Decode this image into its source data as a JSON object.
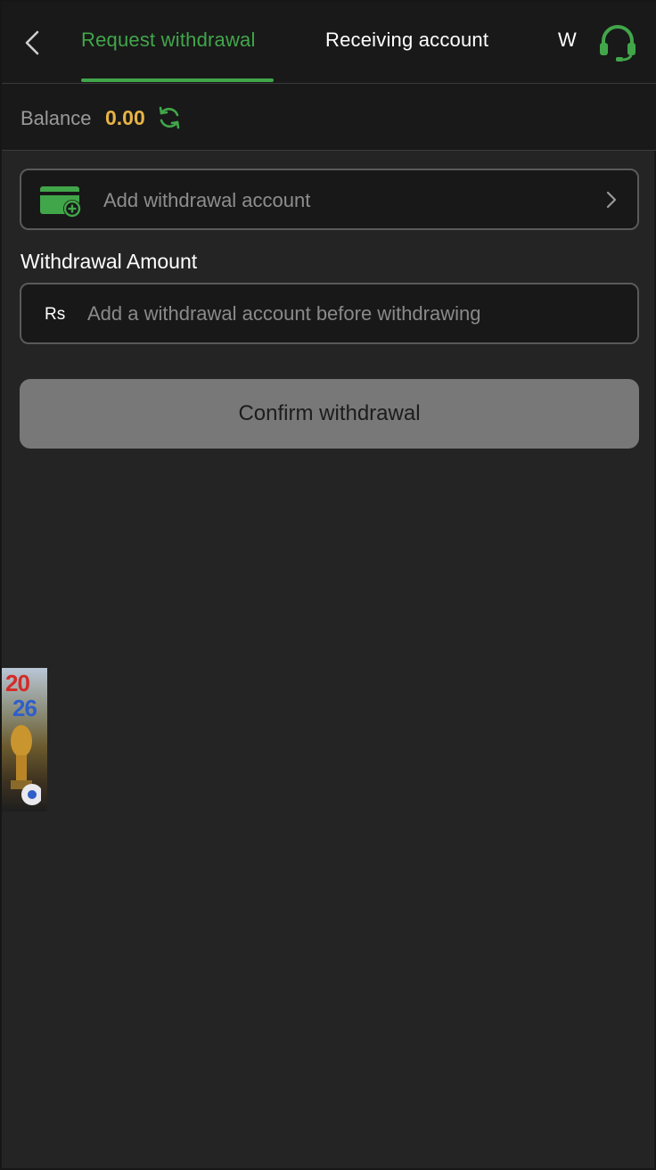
{
  "header": {
    "tabs": [
      {
        "label": "Request withdrawal",
        "active": true
      },
      {
        "label": "Receiving account",
        "active": false
      },
      {
        "label": "W",
        "active": false
      }
    ],
    "back_icon": "chevron-left-icon",
    "support_icon": "headset-icon"
  },
  "balance": {
    "label": "Balance",
    "value": "0.00",
    "refresh_icon": "refresh-icon"
  },
  "add_account": {
    "label": "Add withdrawal account",
    "icon": "wallet-plus-icon",
    "chevron_icon": "chevron-right-icon"
  },
  "amount": {
    "label": "Withdrawal Amount",
    "currency": "Rs",
    "value": "",
    "placeholder": "Add a withdrawal account before withdrawing"
  },
  "confirm_button": {
    "label": "Confirm withdrawal"
  },
  "promo_banner": {
    "digits_top": "20",
    "digits_bottom": "26"
  },
  "colors": {
    "accent": "#41a64a",
    "balance_value": "#e8b444",
    "background": "#242424",
    "header_background": "#191919",
    "button_disabled": "#787878"
  }
}
